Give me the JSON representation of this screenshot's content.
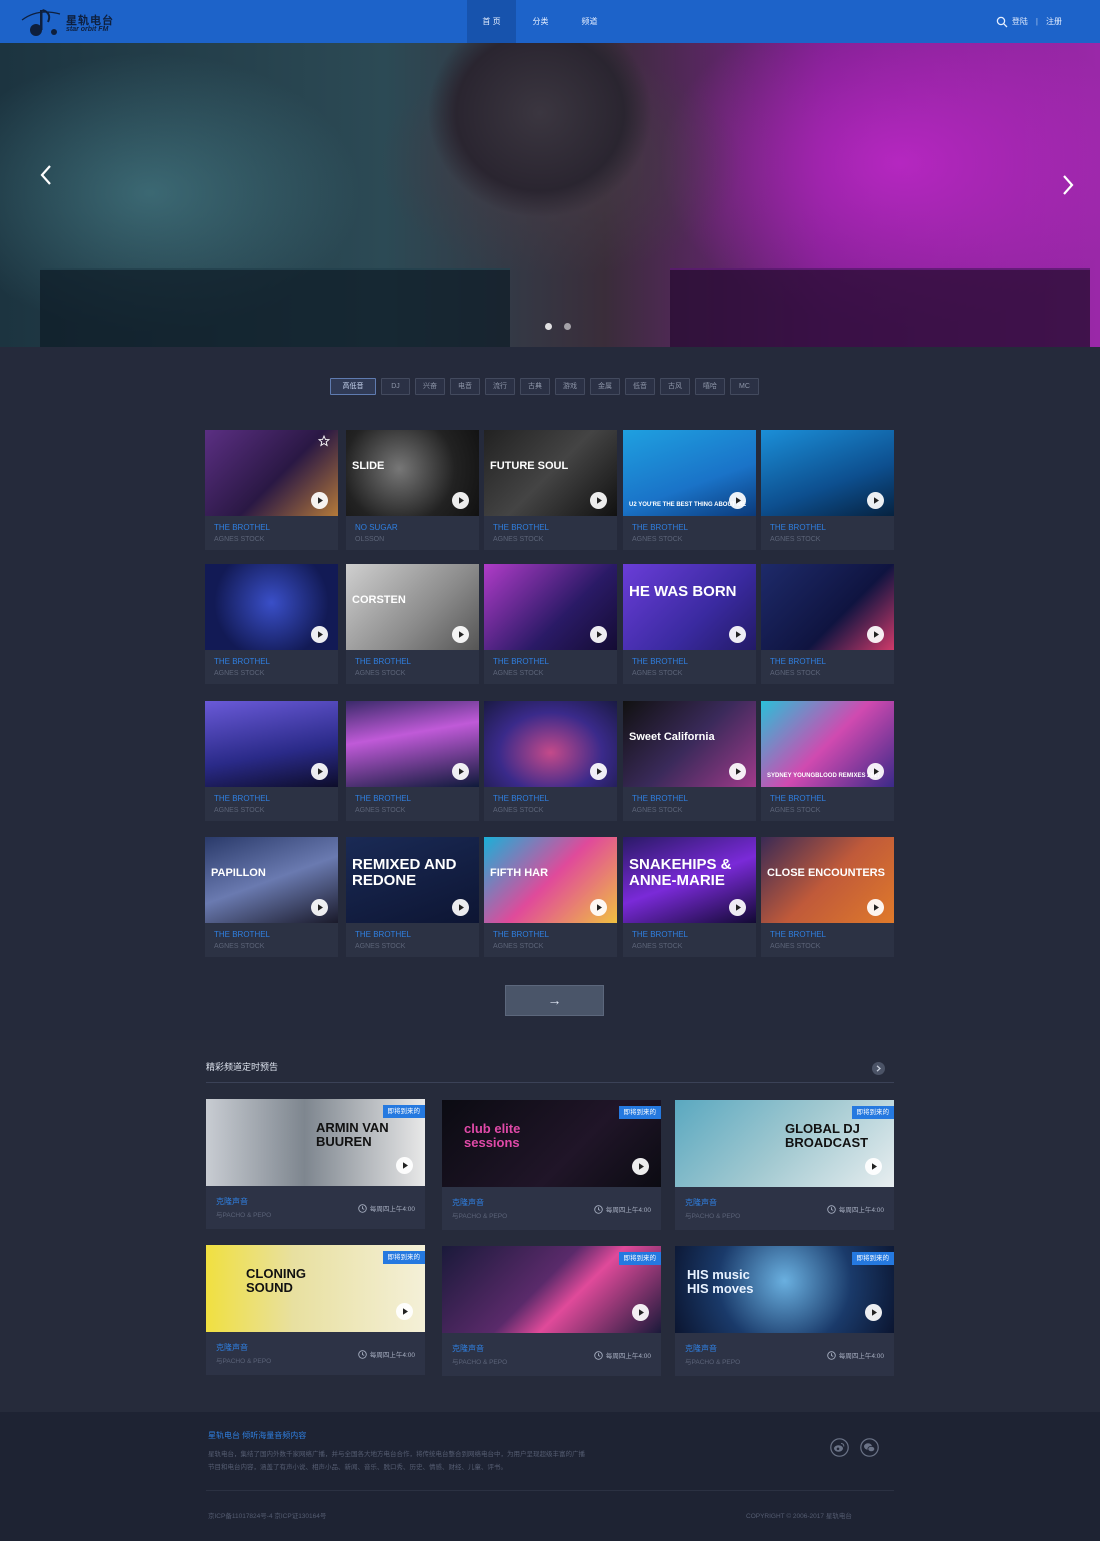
{
  "header": {
    "logo_cn": "星轨电台",
    "logo_en": "star orbit FM",
    "nav": [
      "首 页",
      "分类",
      "频道"
    ],
    "login": "登陆",
    "register": "注册"
  },
  "colors": {
    "brand": "#1d63c9",
    "accent": "#2f7fe0",
    "background": "#252a3b",
    "card": "#2c3244"
  },
  "hero": {
    "active_dot": 1,
    "dot_count": 2
  },
  "filters": [
    "高低音",
    "DJ",
    "兴奋",
    "电音",
    "流行",
    "古典",
    "游戏",
    "金属",
    "低音",
    "古风",
    "嘻哈",
    "MC"
  ],
  "grid": [
    {
      "title": "THE BROTHEL",
      "artist": "AGNES STOCK",
      "art": ""
    },
    {
      "title": "NO SUGAR",
      "artist": "OLSSON",
      "art": "SLIDE"
    },
    {
      "title": "THE BROTHEL",
      "artist": "AGNES STOCK",
      "art": "FUTURE SOUL"
    },
    {
      "title": "THE BROTHEL",
      "artist": "AGNES STOCK",
      "art": "U2 YOU'RE THE BEST THING ABOUT ME"
    },
    {
      "title": "THE BROTHEL",
      "artist": "AGNES STOCK",
      "art": ""
    },
    {
      "title": "THE BROTHEL",
      "artist": "AGNES STOCK",
      "art": ""
    },
    {
      "title": "THE BROTHEL",
      "artist": "AGNES STOCK",
      "art": "CORSTEN"
    },
    {
      "title": "THE BROTHEL",
      "artist": "AGNES STOCK",
      "art": ""
    },
    {
      "title": "THE BROTHEL",
      "artist": "AGNES STOCK",
      "art": "HE WAS BORN"
    },
    {
      "title": "THE BROTHEL",
      "artist": "AGNES STOCK",
      "art": ""
    },
    {
      "title": "THE BROTHEL",
      "artist": "AGNES STOCK",
      "art": ""
    },
    {
      "title": "THE BROTHEL",
      "artist": "AGNES STOCK",
      "art": ""
    },
    {
      "title": "THE BROTHEL",
      "artist": "AGNES STOCK",
      "art": ""
    },
    {
      "title": "THE BROTHEL",
      "artist": "AGNES STOCK",
      "art": "Sweet California"
    },
    {
      "title": "THE BROTHEL",
      "artist": "AGNES STOCK",
      "art": "SYDNEY YOUNGBLOOD REMIXES 2017"
    },
    {
      "title": "THE BROTHEL",
      "artist": "AGNES STOCK",
      "art": "PAPILLON"
    },
    {
      "title": "THE BROTHEL",
      "artist": "AGNES STOCK",
      "art": "REMIXED AND REDONE"
    },
    {
      "title": "THE BROTHEL",
      "artist": "AGNES STOCK",
      "art": "FIFTH HAR"
    },
    {
      "title": "THE BROTHEL",
      "artist": "AGNES STOCK",
      "art": "SNAKEHIPS & ANNE-MARIE"
    },
    {
      "title": "THE BROTHEL",
      "artist": "AGNES STOCK",
      "art": "CLOSE ENCOUNTERS"
    }
  ],
  "more_button": "→",
  "schedule": {
    "title": "精彩频道定时预告",
    "items": [
      {
        "badge": "即将到来的",
        "title": "克隆声音",
        "sub": "与PACHO & PEPO",
        "time": "每周四上午4:00",
        "art": "ARMIN VAN BUUREN"
      },
      {
        "badge": "即将到来的",
        "title": "克隆声音",
        "sub": "与PACHO & PEPO",
        "time": "每周四上午4:00",
        "art": "club elite sessions"
      },
      {
        "badge": "即将到来的",
        "title": "克隆声音",
        "sub": "与PACHO & PEPO",
        "time": "每周四上午4:00",
        "art": "GLOBAL DJ BROADCAST"
      },
      {
        "badge": "即将到来的",
        "title": "克隆声音",
        "sub": "与PACHO & PEPO",
        "time": "每周四上午4:00",
        "art": "CLONING SOUND"
      },
      {
        "badge": "即将到来的",
        "title": "克隆声音",
        "sub": "与PACHO & PEPO",
        "time": "每周四上午4:00",
        "art": ""
      },
      {
        "badge": "即将到来的",
        "title": "克隆声音",
        "sub": "与PACHO & PEPO",
        "time": "每周四上午4:00",
        "art": "HIS music HIS moves"
      }
    ]
  },
  "footer": {
    "title": "星轨电台  倾听海量音频内容",
    "desc": "星轨电台，集结了国内外数千家网络广播，并与全国各大地方电台合作，将传统电台整合到网络电台中，为用户呈现超级丰富的广播节目和电台内容，涵盖了有声小说、相声小品、新闻、音乐、脱口秀、历史、情感、财经、儿童、评书。",
    "icp": "京ICP备11017824号-4  京ICP证130164号",
    "copyright": "COPYRIGHT © 2006-2017 星轨电台"
  }
}
